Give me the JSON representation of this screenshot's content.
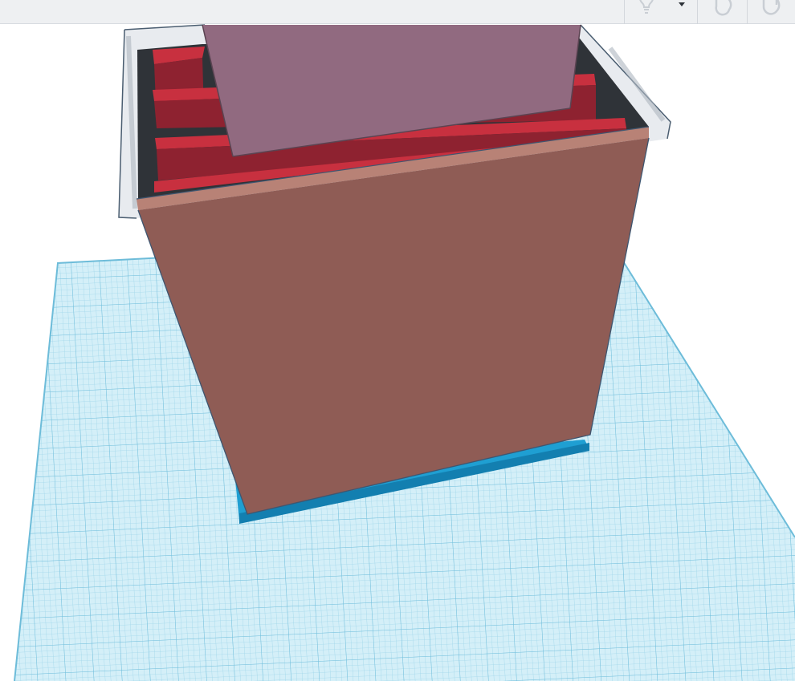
{
  "toolbar": {
    "buttons": [
      {
        "name": "lightbulb-button",
        "icon": "lightbulb-icon"
      },
      {
        "name": "light-dropdown-button",
        "icon": "caret-down-icon"
      },
      {
        "name": "rotate-left-button",
        "icon": "rotate-left-icon"
      },
      {
        "name": "rotate-right-button",
        "icon": "rotate-right-icon"
      }
    ]
  },
  "colors": {
    "toolbar_bg": "#eef0f2",
    "workplane": "#bfe6f3",
    "grid_minor": "#9fd6ea",
    "grid_major": "#72bfdc",
    "base_plate": "#1f9fd2",
    "front_wall": "#8f5c55",
    "front_wall_edge": "#a6776e",
    "inner_box": "#916a80",
    "divider_red": "#c8303f",
    "divider_dark": "#8e2230",
    "interior_dark": "#2f3338",
    "transparent_shell": "#e4e8ec"
  }
}
